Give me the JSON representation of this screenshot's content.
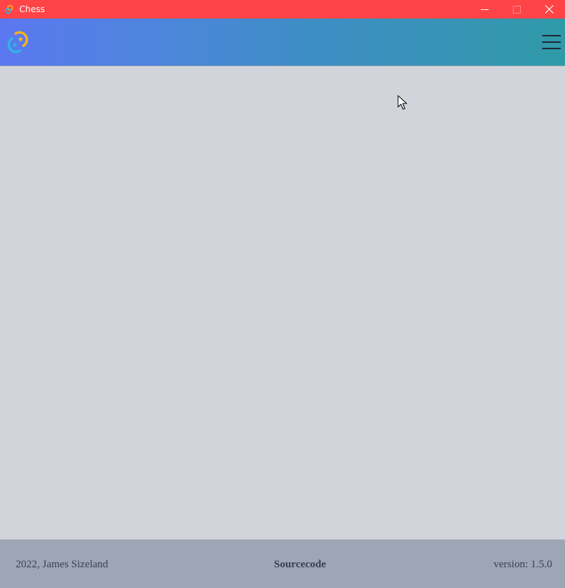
{
  "window": {
    "title": "Chess",
    "titlebar_color": "#ff4448",
    "controls": [
      "minimize-icon",
      "maximize-icon",
      "close-icon"
    ]
  },
  "appbar": {
    "logo": "tauri-logo-icon",
    "menu": "hamburger-menu-icon",
    "gradient_from": "#5b78f0",
    "gradient_to": "#2f9aa8"
  },
  "footer": {
    "copyright": "2022, James Sizeland",
    "source_link": "Sourcecode",
    "version": "version: 1.5.0"
  }
}
